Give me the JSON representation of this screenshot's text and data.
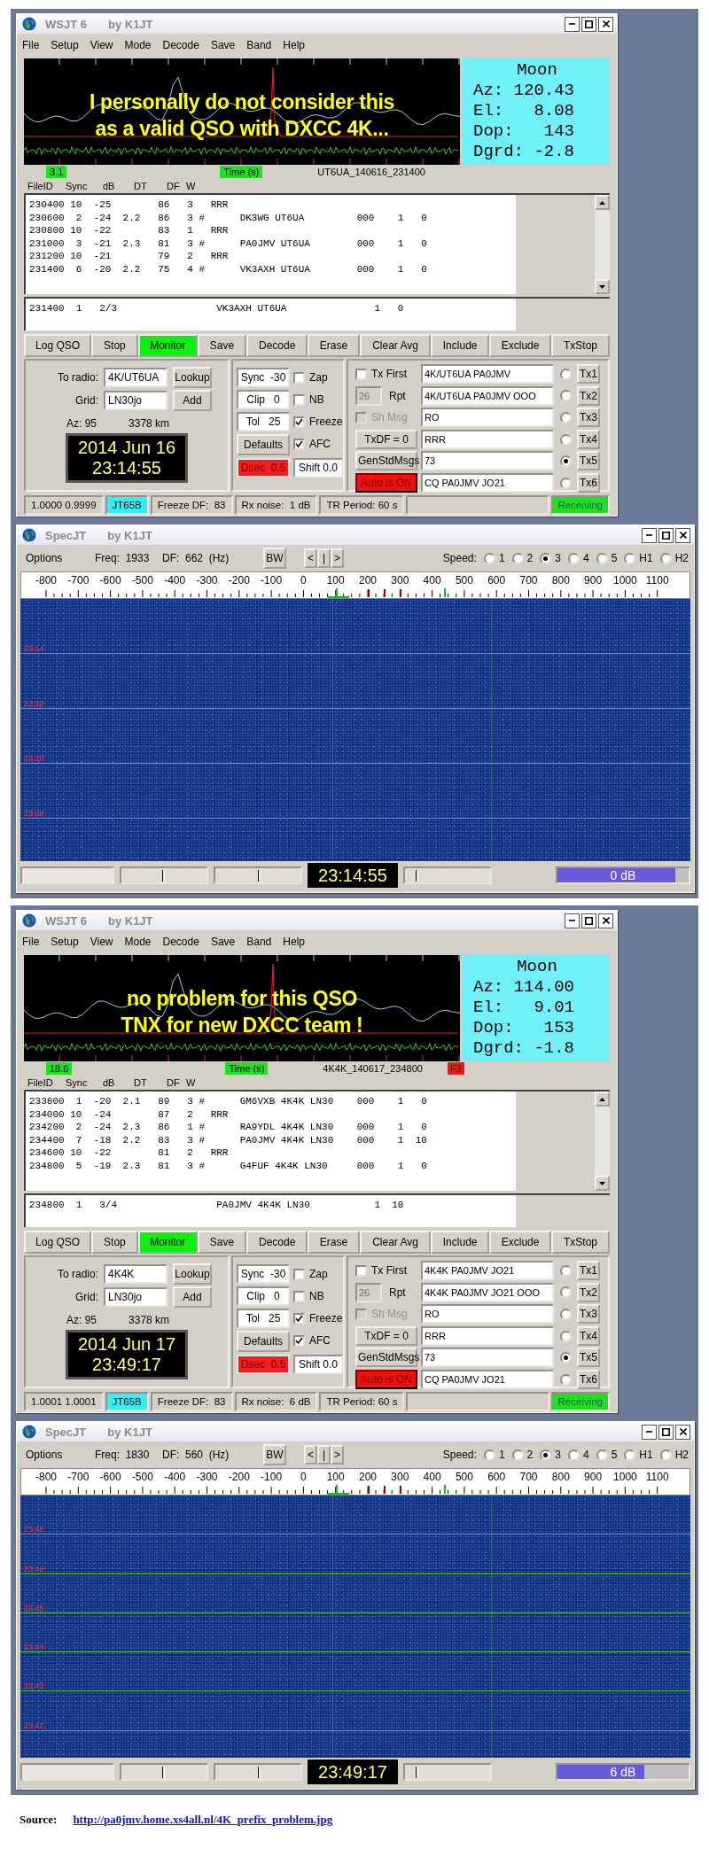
{
  "panels": [
    {
      "wsjt": {
        "title": "WSJT 6",
        "subtitle": "by K1JT",
        "menu": [
          "File",
          "Setup",
          "View",
          "Mode",
          "Decode",
          "Save",
          "Band",
          "Help"
        ],
        "annotation": [
          "I personally do not consider this",
          "as a valid QSO with DXCC 4K..."
        ],
        "moon": {
          "title": "Moon",
          "lines": [
            "Az: 120.43",
            "El:   8.08",
            "Dop:   143",
            "Dgrd: -2.8"
          ]
        },
        "plot_labels": [
          {
            "text": "3.1",
            "kind": "sync"
          },
          {
            "text": "Time (s)",
            "kind": "axis"
          },
          {
            "text": "UT6UA_140616_231400",
            "kind": "file"
          }
        ],
        "columns": [
          "FileID",
          "Sync",
          "dB",
          "DT",
          "DF",
          "W"
        ],
        "decodes": [
          "230400 10  -25        86   3   RRR",
          "230600  2  -24  2.2   86   3 #      DK3WG UT6UA         000    1   0",
          "230800 10  -22        83   1   RRR",
          "231000  3  -21  2.3   81   3 #      PA0JMV UT6UA        000    1   0",
          "231200 10  -21        79   2   RRR",
          "231400  6  -20  2.2   75   4 #      VK3AXH UT6UA        000    1   0"
        ],
        "average": [
          "231400  1   2/3                 VK3AXH UT6UA               1   0"
        ],
        "buttons": [
          {
            "label": "Log QSO",
            "active": false
          },
          {
            "label": "Stop",
            "active": false
          },
          {
            "label": "Monitor",
            "active": true
          },
          {
            "label": "Save",
            "active": false
          },
          {
            "label": "Decode",
            "active": false
          },
          {
            "label": "Erase",
            "active": false
          },
          {
            "label": "Clear Avg",
            "active": false
          },
          {
            "label": "Include",
            "active": false
          },
          {
            "label": "Exclude",
            "active": false
          },
          {
            "label": "TxStop",
            "active": false
          }
        ],
        "station": {
          "to_radio": {
            "label": "To radio:",
            "value": "4K/UT6UA",
            "button": "Lookup"
          },
          "grid": {
            "label": "Grid:",
            "value": "LN30jo",
            "button": "Add"
          },
          "azimuth": "Az: 95",
          "distance": "3378 km",
          "date": "2014 Jun 16",
          "time": "23:14:55"
        },
        "settings": [
          {
            "text": "Sync  -30",
            "kind": "readout"
          },
          {
            "text": "Clip   0",
            "kind": "readout"
          },
          {
            "text": "Tol   25",
            "kind": "readout"
          },
          {
            "text": "Defaults",
            "kind": "button"
          },
          {
            "text": "Dsec  0.5",
            "kind": "alarm"
          }
        ],
        "options": [
          {
            "text": "Zap",
            "kind": "check",
            "checked": false
          },
          {
            "text": "NB",
            "kind": "check",
            "checked": false
          },
          {
            "text": "Freeze",
            "kind": "check",
            "checked": true
          },
          {
            "text": "AFC",
            "kind": "check",
            "checked": true
          },
          {
            "text": "Shift 0.0",
            "kind": "readout"
          }
        ],
        "tx_controls": [
          {
            "kind": "check",
            "text": "Tx First",
            "checked": false,
            "disabled": false
          },
          {
            "kind": "field",
            "value": "26",
            "text": "Rpt",
            "disabled": true
          },
          {
            "kind": "check",
            "text": "Sh Msg",
            "checked": false,
            "disabled": true
          },
          {
            "kind": "button",
            "text": "TxDF = 0"
          },
          {
            "kind": "button",
            "text": "GenStdMsgs"
          },
          {
            "kind": "toggle",
            "text": "Auto is ON",
            "on": true
          }
        ],
        "messages": [
          {
            "text": "4K/UT6UA PA0JMV",
            "selected": false,
            "button": "Tx1"
          },
          {
            "text": "4K/UT6UA PA0JMV OOO",
            "selected": false,
            "button": "Tx2"
          },
          {
            "text": "RO",
            "selected": false,
            "button": "Tx3"
          },
          {
            "text": "RRR",
            "selected": false,
            "button": "Tx4"
          },
          {
            "text": "73",
            "selected": true,
            "button": "Tx5"
          },
          {
            "text": "CQ PA0JMV JO21",
            "selected": false,
            "button": "Tx6"
          }
        ],
        "status": [
          {
            "text": "1.0000 0.9999",
            "kind": "plain"
          },
          {
            "text": "JT65B",
            "kind": "mode"
          },
          {
            "text": "Freeze DF:  83",
            "kind": "plain"
          },
          {
            "text": "Rx noise:  1 dB",
            "kind": "plain"
          },
          {
            "text": "TR Period: 60 s",
            "kind": "plain"
          },
          {
            "text": "Receiving",
            "kind": "state"
          }
        ]
      },
      "spec": {
        "title": "SpecJT",
        "subtitle": "by K1JT",
        "options": "Options",
        "freq": "Freq:  1933",
        "df": "DF:  662  (Hz)",
        "bw": "BW",
        "nav": [
          "<",
          "|",
          ">"
        ],
        "speed_label": "Speed:",
        "speeds": [
          {
            "label": "1",
            "selected": false
          },
          {
            "label": "2",
            "selected": false
          },
          {
            "label": "3",
            "selected": true
          },
          {
            "label": "4",
            "selected": false
          },
          {
            "label": "5",
            "selected": false
          },
          {
            "label": "H1",
            "selected": false
          },
          {
            "label": "H2",
            "selected": false
          }
        ],
        "scale": [
          "-800",
          "-700",
          "-600",
          "-500",
          "-400",
          "-300",
          "-200",
          "-100",
          "0",
          "100",
          "200",
          "300",
          "400",
          "500",
          "600",
          "700",
          "800",
          "900",
          "1000",
          "1100"
        ],
        "time_marks": [
          "23:14",
          "23:12",
          "23:10",
          "23:08"
        ],
        "sliders": [
          {
            "level": 0.5
          },
          {
            "level": 0.52
          },
          {
            "level": 0.15
          }
        ],
        "clock": "23:14:55",
        "meter": {
          "reading": "0 dB",
          "level": 0.9
        }
      }
    },
    {
      "wsjt": {
        "title": "WSJT 6",
        "subtitle": "by K1JT",
        "menu": [
          "File",
          "Setup",
          "View",
          "Mode",
          "Decode",
          "Save",
          "Band",
          "Help"
        ],
        "annotation": [
          "no problem for this QSO",
          "TNX for new DXCC team !"
        ],
        "moon": {
          "title": "Moon",
          "lines": [
            "Az: 114.00",
            "El:   9.01",
            "Dop:   153",
            "Dgrd: -1.8"
          ]
        },
        "plot_labels": [
          {
            "text": "18.6",
            "kind": "sync"
          },
          {
            "text": "Time (s)",
            "kind": "axis"
          },
          {
            "text": "4K4K_140617_234800",
            "kind": "file"
          },
          {
            "text": "F3",
            "kind": "flag"
          }
        ],
        "columns": [
          "FileID",
          "Sync",
          "dB",
          "DT",
          "DF",
          "W"
        ],
        "decodes": [
          "233800  1  -20  2.1   89   3 #      GM6VXB 4K4K LN30    000    1   0",
          "234000 10  -24        87   2   RRR",
          "234200  2  -24  2.3   86   1 #      RA9YDL 4K4K LN30    000    1   0",
          "234400  7  -18  2.2   83   3 #      PA0JMV 4K4K LN30    000    1  10",
          "234600 10  -22        81   2   RRR",
          "234800  5  -19  2.3   81   3 #      G4FUF 4K4K LN30     000    1   0"
        ],
        "average": [
          "234800  1   3/4                 PA0JMV 4K4K LN30           1  10"
        ],
        "buttons": [
          {
            "label": "Log QSO",
            "active": false
          },
          {
            "label": "Stop",
            "active": false
          },
          {
            "label": "Monitor",
            "active": true
          },
          {
            "label": "Save",
            "active": false
          },
          {
            "label": "Decode",
            "active": false
          },
          {
            "label": "Erase",
            "active": false
          },
          {
            "label": "Clear Avg",
            "active": false
          },
          {
            "label": "Include",
            "active": false
          },
          {
            "label": "Exclude",
            "active": false
          },
          {
            "label": "TxStop",
            "active": false
          }
        ],
        "station": {
          "to_radio": {
            "label": "To radio:",
            "value": "4K4K",
            "button": "Lookup"
          },
          "grid": {
            "label": "Grid:",
            "value": "LN30jo",
            "button": "Add"
          },
          "azimuth": "Az: 95",
          "distance": "3378 km",
          "date": "2014 Jun 17",
          "time": "23:49:17"
        },
        "settings": [
          {
            "text": "Sync  -30",
            "kind": "readout"
          },
          {
            "text": "Clip   0",
            "kind": "readout"
          },
          {
            "text": "Tol   25",
            "kind": "readout"
          },
          {
            "text": "Defaults",
            "kind": "button"
          },
          {
            "text": "Dsec  0.5",
            "kind": "alarm"
          }
        ],
        "options": [
          {
            "text": "Zap",
            "kind": "check",
            "checked": false
          },
          {
            "text": "NB",
            "kind": "check",
            "checked": false
          },
          {
            "text": "Freeze",
            "kind": "check",
            "checked": true
          },
          {
            "text": "AFC",
            "kind": "check",
            "checked": true
          },
          {
            "text": "Shift 0.0",
            "kind": "readout"
          }
        ],
        "tx_controls": [
          {
            "kind": "check",
            "text": "Tx First",
            "checked": false,
            "disabled": false
          },
          {
            "kind": "field",
            "value": "26",
            "text": "Rpt",
            "disabled": true
          },
          {
            "kind": "check",
            "text": "Sh Msg",
            "checked": false,
            "disabled": true
          },
          {
            "kind": "button",
            "text": "TxDF = 0"
          },
          {
            "kind": "button",
            "text": "GenStdMsgs"
          },
          {
            "kind": "toggle",
            "text": "Auto is ON",
            "on": true
          }
        ],
        "messages": [
          {
            "text": "4K4K PA0JMV JO21",
            "selected": false,
            "button": "Tx1"
          },
          {
            "text": "4K4K PA0JMV JO21 OOO",
            "selected": false,
            "button": "Tx2"
          },
          {
            "text": "RO",
            "selected": false,
            "button": "Tx3"
          },
          {
            "text": "RRR",
            "selected": false,
            "button": "Tx4"
          },
          {
            "text": "73",
            "selected": true,
            "button": "Tx5"
          },
          {
            "text": "CQ PA0JMV JO21",
            "selected": false,
            "button": "Tx6"
          }
        ],
        "status": [
          {
            "text": "1.0001 1.0001",
            "kind": "plain"
          },
          {
            "text": "JT65B",
            "kind": "mode"
          },
          {
            "text": "Freeze DF:  83",
            "kind": "plain"
          },
          {
            "text": "Rx noise:  6 dB",
            "kind": "plain"
          },
          {
            "text": "TR Period: 60 s",
            "kind": "plain"
          },
          {
            "text": "Receiving",
            "kind": "state"
          }
        ]
      },
      "spec": {
        "title": "SpecJT",
        "subtitle": "by K1JT",
        "options": "Options",
        "freq": "Freq:  1830",
        "df": "DF:  560  (Hz)",
        "bw": "BW",
        "nav": [
          "<",
          "|",
          ">"
        ],
        "speed_label": "Speed:",
        "speeds": [
          {
            "label": "1",
            "selected": false
          },
          {
            "label": "2",
            "selected": false
          },
          {
            "label": "3",
            "selected": true
          },
          {
            "label": "4",
            "selected": false
          },
          {
            "label": "5",
            "selected": false
          },
          {
            "label": "H1",
            "selected": false
          },
          {
            "label": "H2",
            "selected": false
          }
        ],
        "scale": [
          "-800",
          "-700",
          "-600",
          "-500",
          "-400",
          "-300",
          "-200",
          "-100",
          "0",
          "100",
          "200",
          "300",
          "400",
          "500",
          "600",
          "700",
          "800",
          "900",
          "1000",
          "1100"
        ],
        "time_marks": [
          "23:48",
          "23:46",
          "23:45",
          "23:44",
          "23:43",
          "23:42"
        ],
        "sliders": [
          {
            "level": 0.5
          },
          {
            "level": 0.52
          },
          {
            "level": 0.15
          }
        ],
        "clock": "23:49:17",
        "meter": {
          "reading": "6 dB",
          "level": 0.66
        }
      }
    }
  ],
  "source": {
    "label": "Source:",
    "url": "http://pa0jmv.home.xs4all.nl/4K_prefix_problem.jpg"
  }
}
